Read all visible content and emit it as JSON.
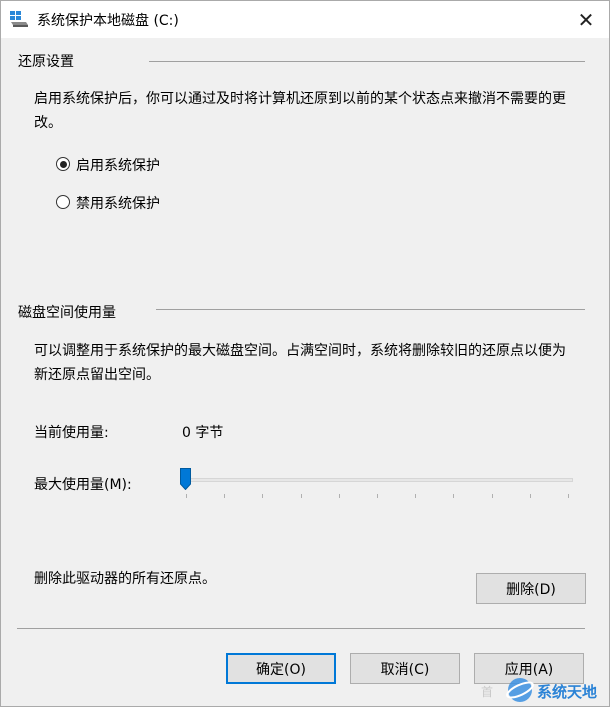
{
  "window": {
    "title": "系统保护本地磁盘 (C:)",
    "close_glyph": "✕"
  },
  "restore": {
    "group_title": "还原设置",
    "description": "启用系统保护后，你可以通过及时将计算机还原到以前的某个状态点来撤消不需要的更改。",
    "options": [
      {
        "label": "启用系统保护",
        "selected": true
      },
      {
        "label": "禁用系统保护",
        "selected": false
      }
    ]
  },
  "disk": {
    "group_title": "磁盘空间使用量",
    "description": "可以调整用于系统保护的最大磁盘空间。占满空间时，系统将删除较旧的还原点以便为新还原点留出空间。",
    "current_usage_label": "当前使用量:",
    "current_usage_value": "0 字节",
    "max_usage_label": "最大使用量(M):",
    "max_usage_fraction": 0.0
  },
  "delete": {
    "text": "删除此驱动器的所有还原点。",
    "button": "删除(D)"
  },
  "footer": {
    "ok": "确定(O)",
    "cancel": "取消(C)",
    "apply": "应用(A)"
  },
  "watermark": {
    "text": "系统天地",
    "ghost": "首"
  },
  "colors": {
    "accent": "#0078d7",
    "window_bg": "#f0f0f0",
    "titlebar_bg": "#ffffff"
  }
}
